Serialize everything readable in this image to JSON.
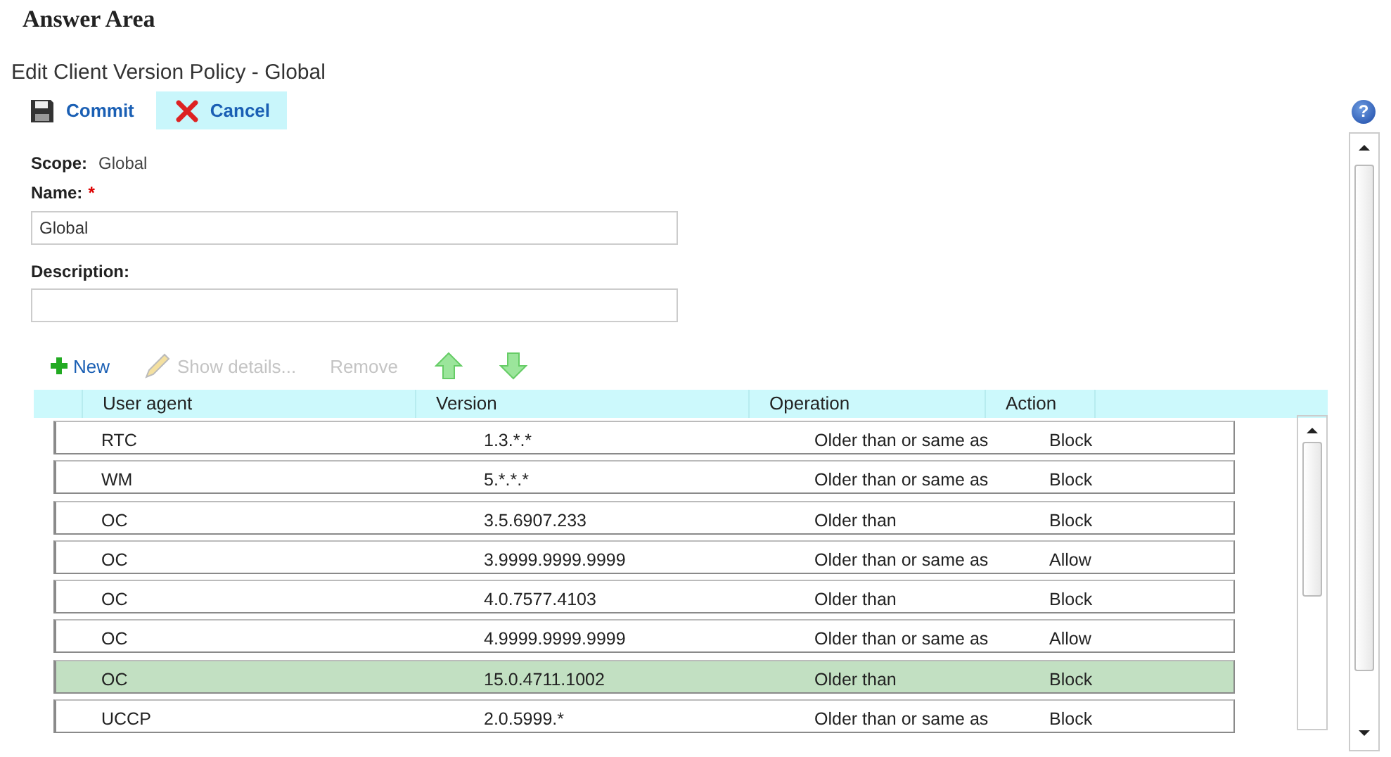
{
  "heading": "Answer Area",
  "window": {
    "title": "Edit Client Version Policy - Global",
    "help": "?"
  },
  "actions": [
    {
      "label": "Commit",
      "kind": "save",
      "selected": false
    },
    {
      "label": "Cancel",
      "kind": "cancel",
      "selected": true
    }
  ],
  "scope": {
    "label": "Scope:",
    "value": "Global"
  },
  "name_field": {
    "label": "Name:",
    "required_mark": "*",
    "value": "Global"
  },
  "description_field": {
    "label": "Description:"
  },
  "grid_toolbar": [
    {
      "label": "New",
      "kind": "new",
      "disabled": false
    },
    {
      "label": "Show details...",
      "kind": "edit",
      "disabled": true
    },
    {
      "label": "Remove",
      "kind": "text",
      "disabled": true
    },
    {
      "kind": "up",
      "disabled": false
    },
    {
      "kind": "down",
      "disabled": false
    }
  ],
  "table": {
    "columns": [
      "User agent",
      "Version",
      "Operation",
      "Action"
    ],
    "rows": [
      {
        "cells": [
          "RTC",
          "1.3.*.*",
          "Older than or same as",
          "Block"
        ],
        "selected": false
      },
      {
        "cells": [
          "WM",
          "5.*.*.*",
          "Older than or same as",
          "Block"
        ],
        "selected": false
      },
      {
        "cells": [
          "OC",
          "3.5.6907.233",
          "Older than",
          "Block"
        ],
        "selected": false
      },
      {
        "cells": [
          "OC",
          "3.9999.9999.9999",
          "Older than or same as",
          "Allow"
        ],
        "selected": false
      },
      {
        "cells": [
          "OC",
          "4.0.7577.4103",
          "Older than",
          "Block"
        ],
        "selected": false
      },
      {
        "cells": [
          "OC",
          "4.9999.9999.9999",
          "Older than or same as",
          "Allow"
        ],
        "selected": false
      },
      {
        "cells": [
          "OC",
          "15.0.4711.1002",
          "Older than",
          "Block"
        ],
        "selected": true
      },
      {
        "cells": [
          "UCCP",
          "2.0.5999.*",
          "Older than or same as",
          "Block"
        ],
        "selected": false
      }
    ]
  }
}
